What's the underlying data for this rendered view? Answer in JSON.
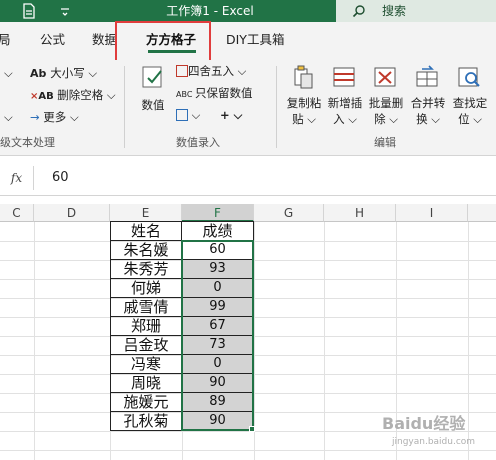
{
  "window": {
    "title": "工作簿1 - Excel",
    "search_label": "搜索"
  },
  "tabs": [
    "局",
    "公式",
    "数据",
    "方方格子",
    "DIY工具箱"
  ],
  "active_tab": "方方格子",
  "ribbon": {
    "text_group": {
      "items": [
        "大小写",
        "删除空格",
        "更多"
      ],
      "label": "级文本处理"
    },
    "number_group": {
      "big_button": "数值",
      "items": [
        "四舍五入",
        "只保留数值"
      ],
      "label": "数值录入"
    },
    "edit_group": {
      "buttons": [
        {
          "line1": "复制粘",
          "line2": "贴"
        },
        {
          "line1": "新增插",
          "line2": "入"
        },
        {
          "line1": "批量删",
          "line2": "除"
        },
        {
          "line1": "合并转",
          "line2": "换"
        },
        {
          "line1": "查找定",
          "line2": "位"
        }
      ],
      "label": "编辑"
    }
  },
  "formula_bar": {
    "fx": "fx",
    "value": "60"
  },
  "columns": [
    "C",
    "D",
    "E",
    "F",
    "G",
    "H",
    "I"
  ],
  "selected_column": "F",
  "table": {
    "headers": [
      "姓名",
      "成绩"
    ],
    "rows": [
      {
        "name": "朱名媛",
        "score": "60"
      },
      {
        "name": "朱秀芳",
        "score": "93"
      },
      {
        "name": "何娣",
        "score": "0"
      },
      {
        "name": "戚雪倩",
        "score": "99"
      },
      {
        "name": "郑珊",
        "score": "67"
      },
      {
        "name": "吕金玫",
        "score": "73"
      },
      {
        "name": "冯寒",
        "score": "0"
      },
      {
        "name": "周晓",
        "score": "90"
      },
      {
        "name": "施媛元",
        "score": "89"
      },
      {
        "name": "孔秋菊",
        "score": "90"
      }
    ]
  },
  "watermark": {
    "big": "Baidu经验",
    "small": "jingyan.baidu.com"
  },
  "colors": {
    "excel_green": "#217346",
    "highlight_red": "#e03c3c",
    "selected_fill": "#d3d3d3"
  }
}
